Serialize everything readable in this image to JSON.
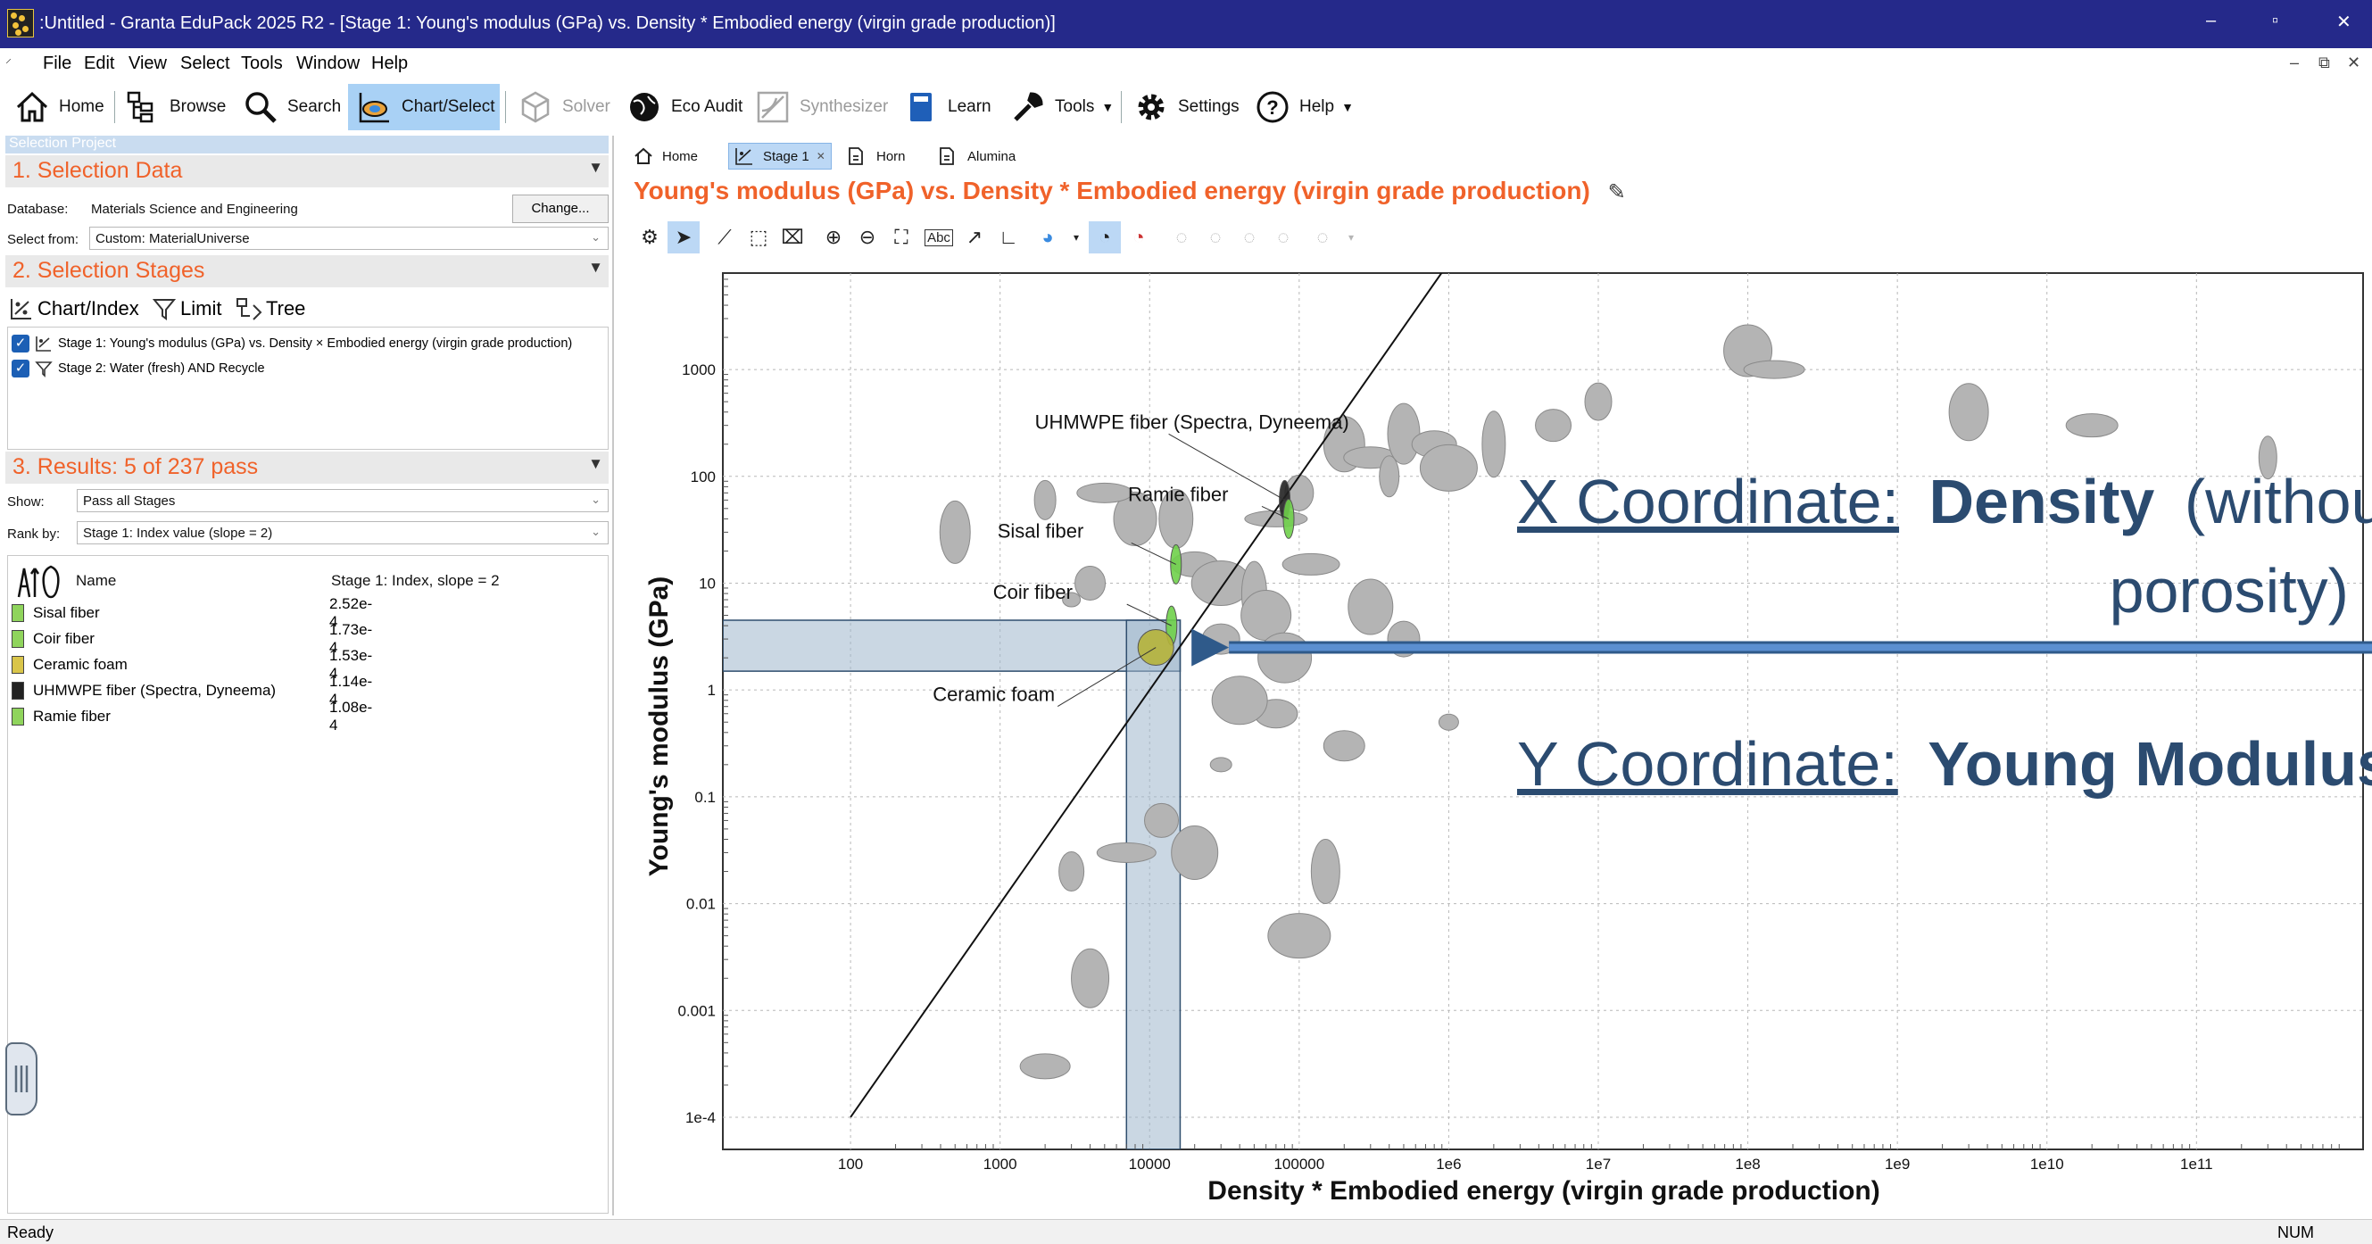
{
  "window": {
    "title": ":Untitled - Granta EduPack 2025 R2 - [Stage 1: Young's modulus (GPa) vs. Density * Embodied energy (virgin grade production)]",
    "minimize": "–",
    "restore": "▫",
    "close": "✕"
  },
  "menu": [
    "File",
    "Edit",
    "View",
    "Select",
    "Tools",
    "Window",
    "Help"
  ],
  "toolbar": {
    "home": "Home",
    "browse": "Browse",
    "search": "Search",
    "chart_select": "Chart/Select",
    "solver": "Solver",
    "eco_audit": "Eco Audit",
    "synthesizer": "Synthesizer",
    "learn": "Learn",
    "tools": "Tools",
    "settings": "Settings",
    "help": "Help"
  },
  "left_panel": {
    "tab": "Selection Project",
    "section1": {
      "title": "1. Selection Data",
      "db_label": "Database:",
      "db_value": "Materials Science and Engineering",
      "change": "Change...",
      "select_from_label": "Select from:",
      "select_from_value": "Custom: MaterialUniverse"
    },
    "section2": {
      "title": "2. Selection Stages",
      "chart_index": "Chart/Index",
      "limit": "Limit",
      "tree": "Tree",
      "stages": [
        "Stage 1: Young's modulus (GPa) vs. Density × Embodied energy (virgin grade production)",
        "Stage 2: Water (fresh) AND Recycle"
      ]
    },
    "section3": {
      "title": "3. Results: 5 of 237 pass",
      "show_label": "Show:",
      "show_value": "Pass all Stages",
      "rank_label": "Rank by:",
      "rank_value": "Stage 1: Index value (slope = 2)",
      "col_name": "Name",
      "col_index": "Stage 1: Index, slope = 2",
      "results": [
        {
          "name": "Sisal fiber",
          "value": "2.52e-4",
          "color": "#8fd45c"
        },
        {
          "name": "Coir fiber",
          "value": "1.73e-4",
          "color": "#8fd45c"
        },
        {
          "name": "Ceramic foam",
          "value": "1.53e-4",
          "color": "#d9c54a"
        },
        {
          "name": "UHMWPE fiber (Spectra, Dyneema)",
          "value": "1.14e-4",
          "color": "#222222"
        },
        {
          "name": "Ramie fiber",
          "value": "1.08e-4",
          "color": "#8fd45c"
        }
      ]
    }
  },
  "doc_tabs": [
    "Home",
    "Stage 1",
    "Horn",
    "Alumina"
  ],
  "chart_title": "Young's modulus (GPa) vs. Density * Embodied energy (virgin grade production)",
  "overlay": {
    "x_prefix": "X Coordinate:",
    "x_bold": "Density",
    "x_rest1": "(without",
    "x_rest2": "porosity)",
    "y_prefix": "Y Coordinate:",
    "y_bold": "Young Modulus"
  },
  "chart_data": {
    "type": "scatter",
    "xlabel": "Density * Embodied energy (virgin grade production)",
    "ylabel": "Young's modulus (GPa)",
    "x_log": true,
    "y_log": true,
    "x_ticks": [
      "100",
      "1000",
      "10000",
      "100000",
      "1e6",
      "1e7",
      "1e8",
      "1e9",
      "1e10",
      "1e11"
    ],
    "y_ticks": [
      "1e-4",
      "0.001",
      "0.01",
      "0.1",
      "1",
      "10",
      "100",
      "1000"
    ],
    "xlim": [
      14,
      1300000000000.0
    ],
    "ylim": [
      5e-05,
      8000
    ],
    "grid": true,
    "selection_line": {
      "slope": 2,
      "points": [
        [
          100,
          0.0001
        ],
        [
          1000000,
          10000
        ]
      ]
    },
    "labeled_points": [
      {
        "name": "UHMWPE fiber (Spectra, Dyneema)",
        "x": 80000,
        "y": 60,
        "color": "#222222"
      },
      {
        "name": "Ramie fiber",
        "x": 85000,
        "y": 40,
        "color": "#6fd04a"
      },
      {
        "name": "Sisal fiber",
        "x": 15000,
        "y": 15,
        "color": "#6fd04a"
      },
      {
        "name": "Coir fiber",
        "x": 14000,
        "y": 4,
        "color": "#6fd04a"
      },
      {
        "name": "Ceramic foam",
        "x": 11000,
        "y": 2.5,
        "color": "#b5b23a"
      }
    ],
    "highlight": {
      "x_range": [
        7000,
        16000
      ],
      "y_range": [
        1.5,
        4.5
      ]
    },
    "other_points": [
      [
        3000,
        7
      ],
      [
        4000,
        10
      ],
      [
        8000,
        40
      ],
      [
        5000,
        70
      ],
      [
        2000,
        60
      ],
      [
        15000,
        40
      ],
      [
        20000,
        15
      ],
      [
        30000,
        10
      ],
      [
        50000,
        8
      ],
      [
        30000,
        3
      ],
      [
        60000,
        5
      ],
      [
        70000,
        40
      ],
      [
        100000,
        70
      ],
      [
        200000,
        200
      ],
      [
        300000,
        150
      ],
      [
        400000,
        100
      ],
      [
        500000,
        250
      ],
      [
        800000,
        200
      ],
      [
        1000000,
        120
      ],
      [
        2000000,
        200
      ],
      [
        5000000,
        300
      ],
      [
        100000000.0,
        1500
      ],
      [
        150000000.0,
        1000
      ],
      [
        10000000.0,
        500
      ],
      [
        3000000000.0,
        400
      ],
      [
        20000000000.0,
        300
      ],
      [
        300000000000.0,
        150
      ],
      [
        500,
        30
      ],
      [
        70000,
        0.6
      ],
      [
        40000,
        0.8
      ],
      [
        30000,
        0.2
      ],
      [
        12000,
        0.06
      ],
      [
        20000,
        0.03
      ],
      [
        7000,
        0.03
      ],
      [
        3000,
        0.02
      ],
      [
        4000,
        0.002
      ],
      [
        2000,
        0.0003
      ],
      [
        100000,
        0.005
      ],
      [
        150000,
        0.02
      ],
      [
        200000,
        0.3
      ],
      [
        80000,
        2
      ],
      [
        1000000,
        0.5
      ],
      [
        500000,
        3
      ],
      [
        300000,
        6
      ],
      [
        120000,
        15
      ]
    ]
  }
}
